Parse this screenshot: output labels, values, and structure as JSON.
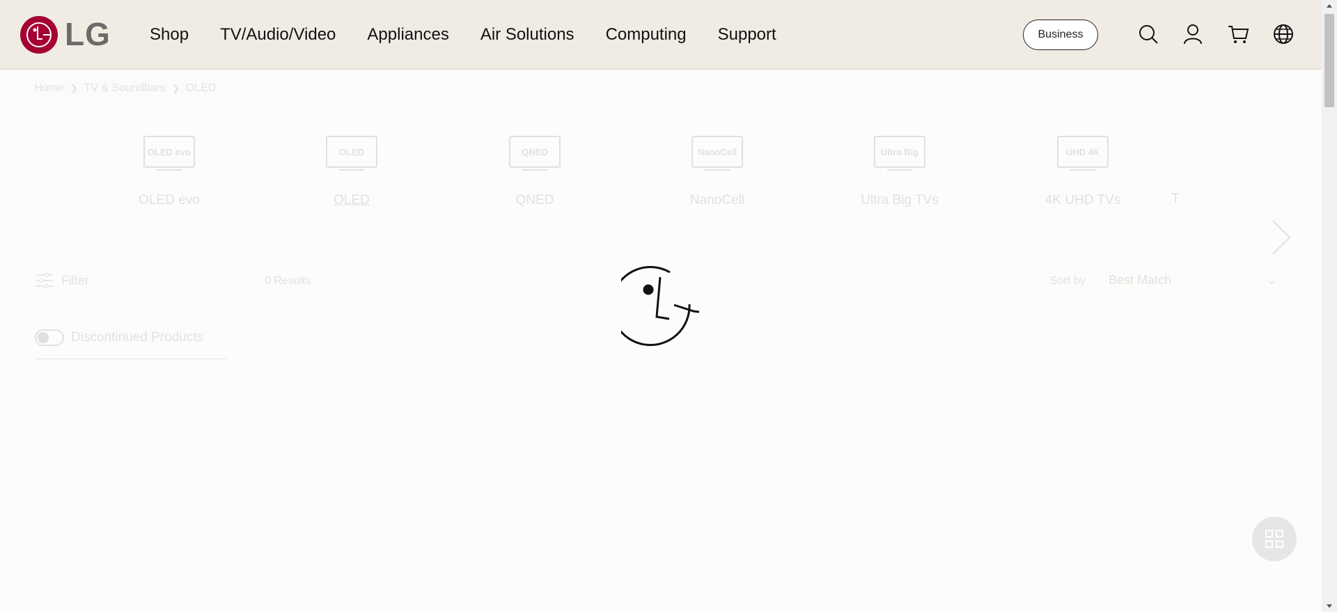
{
  "header": {
    "logo_text": "LG",
    "nav": [
      "Shop",
      "TV/Audio/Video",
      "Appliances",
      "Air Solutions",
      "Computing",
      "Support"
    ],
    "business_label": "Business",
    "icons": [
      "search-icon",
      "account-icon",
      "cart-icon",
      "globe-icon"
    ]
  },
  "breadcrumb": [
    "Home",
    "TV & Soundbars",
    "OLED"
  ],
  "categories": [
    {
      "badge": "OLED evo",
      "label": "OLED evo"
    },
    {
      "badge": "OLED",
      "label": "OLED",
      "active": true
    },
    {
      "badge": "QNED",
      "label": "QNED"
    },
    {
      "badge": "NanoCell",
      "label": "NanoCell"
    },
    {
      "badge": "Ultra Big",
      "label": "Ultra Big TVs"
    },
    {
      "badge": "UHD 4K",
      "label": "4K UHD TVs"
    },
    {
      "badge": "",
      "label": "T"
    }
  ],
  "toolbar": {
    "filter_label": "Filter",
    "results_label": "0 Results",
    "sort_by_label": "Sort by",
    "sort_value": "Best Match"
  },
  "discontinued_label": "Discontinued Products",
  "colors": {
    "brand": "#a50034",
    "header_bg": "#f0ece4",
    "page_bg": "#fcfcfa"
  }
}
